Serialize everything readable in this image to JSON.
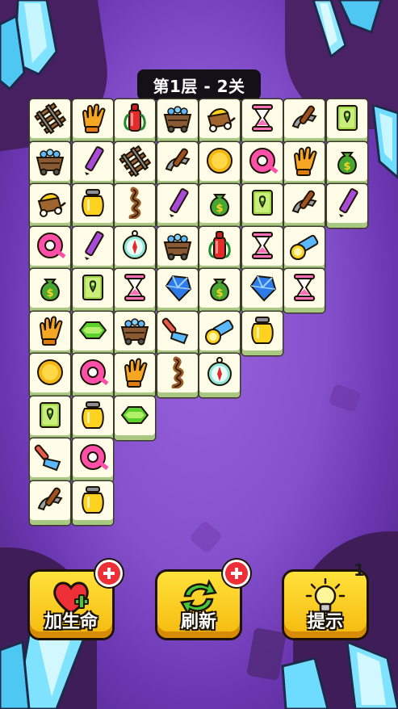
{
  "level_title": "第1层 - 2关",
  "tiles": [
    [
      "rail",
      "glove",
      "bottle",
      "cart",
      "wagon",
      "hourglass",
      "pickaxe",
      "map"
    ],
    [
      "cart",
      "pencil",
      "rail",
      "pickaxe",
      "coin",
      "tape",
      "glove",
      "moneybag"
    ],
    [
      "wagon",
      "jar",
      "rope",
      "pencil",
      "moneybag",
      "map",
      "pickaxe",
      "pencil"
    ],
    [
      "tape",
      "pencil",
      "compass",
      "cart",
      "bottle",
      "hourglass",
      "flashlight"
    ],
    [
      "moneybag",
      "map",
      "hourglass",
      "gem",
      "moneybag",
      "gem",
      "hourglass"
    ],
    [
      "glove",
      "emerald",
      "cart",
      "rake",
      "flashlight",
      "jar"
    ],
    [
      "coin",
      "tape",
      "glove",
      "rope",
      "compass"
    ],
    [
      "map",
      "jar",
      "emerald"
    ],
    [
      "rake",
      "tape"
    ],
    [
      "pickaxe",
      "jar"
    ]
  ],
  "buttons": {
    "add_life": "加生命",
    "refresh": "刷新",
    "hint": "提示",
    "hint_count": "1"
  },
  "icons": {
    "add_life": "heart-plus-icon",
    "refresh": "refresh-arrows-icon",
    "hint": "lightbulb-icon",
    "badge": "plus-icon"
  },
  "colors": {
    "background": "#8450cc",
    "button": "#f9cc1b",
    "tile": "#fffce8",
    "tile_edge": "#a9c882",
    "badge": "#ee2f37"
  }
}
